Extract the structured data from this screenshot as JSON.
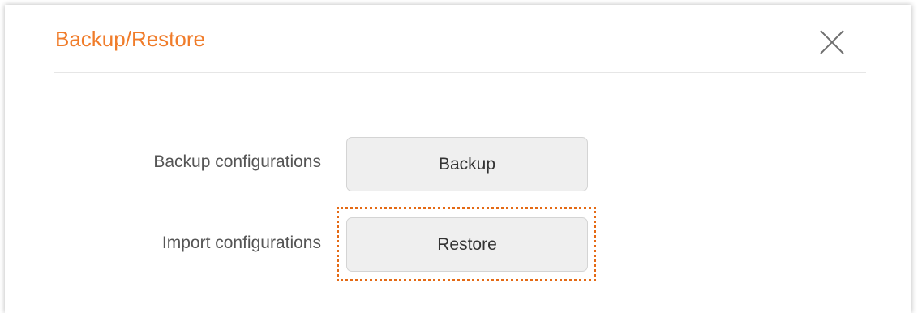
{
  "dialog": {
    "title": "Backup/Restore",
    "close_icon": "close-icon",
    "accent_color": "#f07c2a"
  },
  "rows": {
    "backup": {
      "label": "Backup configurations",
      "button_label": "Backup"
    },
    "import": {
      "label": "Import configurations",
      "button_label": "Restore"
    }
  },
  "highlight": {
    "color": "#e46a15",
    "style": "dotted"
  }
}
